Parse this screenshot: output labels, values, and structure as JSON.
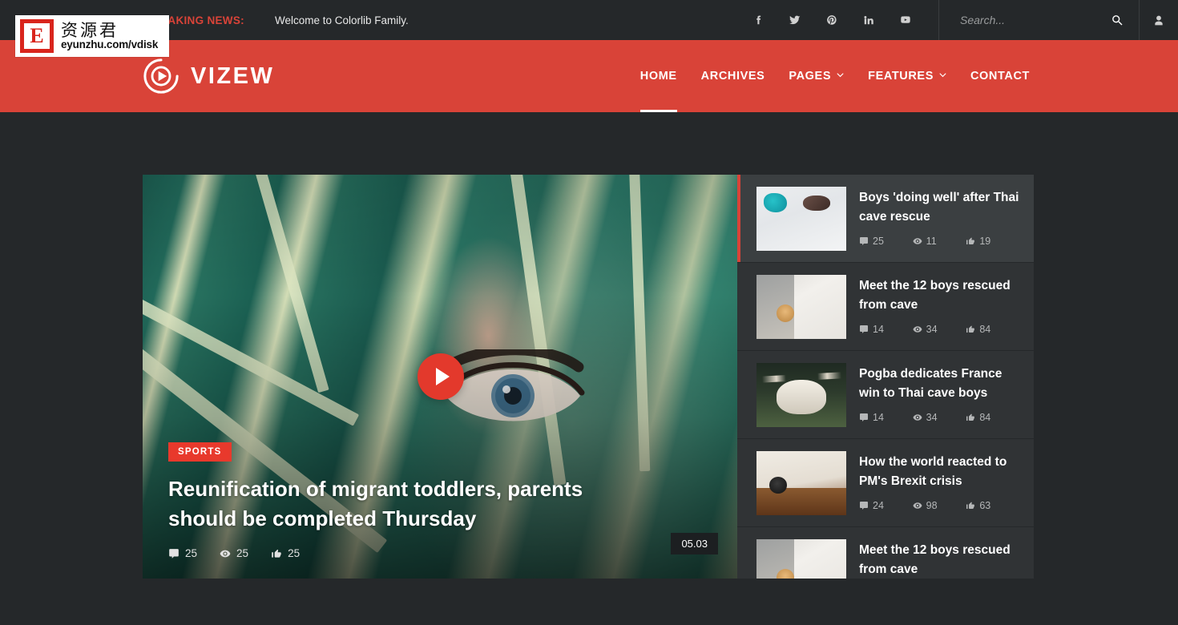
{
  "topbar": {
    "breaking_label": "BREAKING NEWS:",
    "breaking_text": "Welcome to Colorlib Family.",
    "social": [
      {
        "name": "facebook",
        "icon": "facebook-icon"
      },
      {
        "name": "twitter",
        "icon": "twitter-icon"
      },
      {
        "name": "pinterest",
        "icon": "pinterest-icon"
      },
      {
        "name": "linkedin",
        "icon": "linkedin-icon"
      },
      {
        "name": "youtube",
        "icon": "youtube-icon"
      }
    ],
    "search": {
      "placeholder": "Search...",
      "value": "",
      "icon": "search-icon"
    },
    "account_icon": "user-icon"
  },
  "header": {
    "brand": "VIZEW",
    "brand_icon": "play-circle-icon",
    "nav": [
      {
        "label": "HOME",
        "active": true,
        "dropdown": false
      },
      {
        "label": "ARCHIVES",
        "active": false,
        "dropdown": false
      },
      {
        "label": "PAGES",
        "active": false,
        "dropdown": true
      },
      {
        "label": "FEATURES",
        "active": false,
        "dropdown": true
      },
      {
        "label": "CONTACT",
        "active": false,
        "dropdown": false
      }
    ]
  },
  "hero": {
    "category": "SPORTS",
    "title": "Reunification of migrant toddlers, parents should be completed Thursday",
    "comments": "25",
    "views": "25",
    "likes": "25",
    "duration": "05.03",
    "play_icon": "play-icon"
  },
  "sidebar": {
    "items": [
      {
        "title": "Boys 'doing well' after Thai cave rescue",
        "comments": "25",
        "views": "11",
        "likes": "19",
        "active": true,
        "thumb": "th1"
      },
      {
        "title": "Meet the 12 boys rescued from cave",
        "comments": "14",
        "views": "34",
        "likes": "84",
        "active": false,
        "thumb": "th2"
      },
      {
        "title": "Pogba dedicates France win to Thai cave boys",
        "comments": "14",
        "views": "34",
        "likes": "84",
        "active": false,
        "thumb": "th3"
      },
      {
        "title": "How the world reacted to PM's Brexit crisis",
        "comments": "24",
        "views": "98",
        "likes": "63",
        "active": false,
        "thumb": "th4"
      },
      {
        "title": "Meet the 12 boys rescued from cave",
        "comments": "",
        "views": "",
        "likes": "",
        "active": false,
        "thumb": "th5"
      }
    ]
  },
  "watermark": {
    "letter": "E",
    "cn_text": "资源君",
    "url": "eyunzhu.com/vdisk"
  },
  "colors": {
    "brand_red": "#d94338",
    "accent_red": "#e8392c",
    "page_bg": "#25282a",
    "panel_bg": "#303335",
    "panel_active_bg": "#3b3f41"
  }
}
